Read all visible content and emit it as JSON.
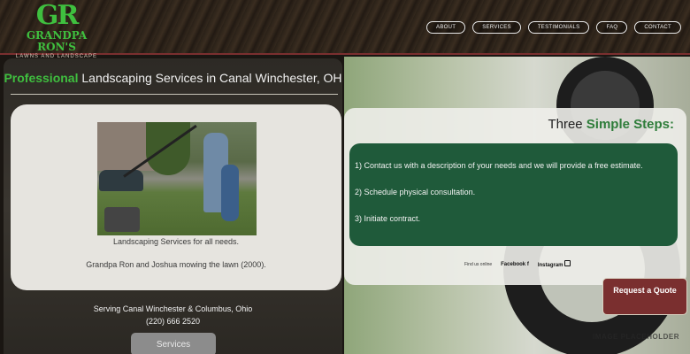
{
  "brand": {
    "monogram": "GR",
    "name": "GRANDPA RON'S",
    "tagline": "LAWNS AND LANDSCAPE"
  },
  "nav": [
    {
      "label": "ABOUT"
    },
    {
      "label": "SERVICES"
    },
    {
      "label": "TESTIMONIALS"
    },
    {
      "label": "FAQ"
    },
    {
      "label": "CONTACT"
    }
  ],
  "left": {
    "title_accent": "Professional",
    "title_rest": " Landscaping Services in Canal Winchester, OH",
    "caption_line1": "Landscaping Services for all needs.",
    "caption_line2": "Grandpa Ron and Joshua mowing the lawn (2000).",
    "serving": "Serving Canal Winchester & Columbus, Ohio",
    "phone": "(220) 666 2520",
    "services_button": "Services"
  },
  "right": {
    "steps_title_plain": "Three ",
    "steps_title_accent": "Simple Steps:",
    "steps": [
      "1) Contact us with a description of your needs and we will provide a free estimate.",
      "2) Schedule physical consultation.",
      "3) Initiate contract."
    ],
    "find_us": "Find us online",
    "facebook": "Facebook",
    "instagram": "Instagram",
    "quote_button": "Request a Quote",
    "image_placeholder": "IMAGE PLACEHOLDER"
  },
  "colors": {
    "accent_green": "#3fbf3f",
    "dark_green": "#1f5a3a",
    "maroon": "#7a2f2f"
  }
}
